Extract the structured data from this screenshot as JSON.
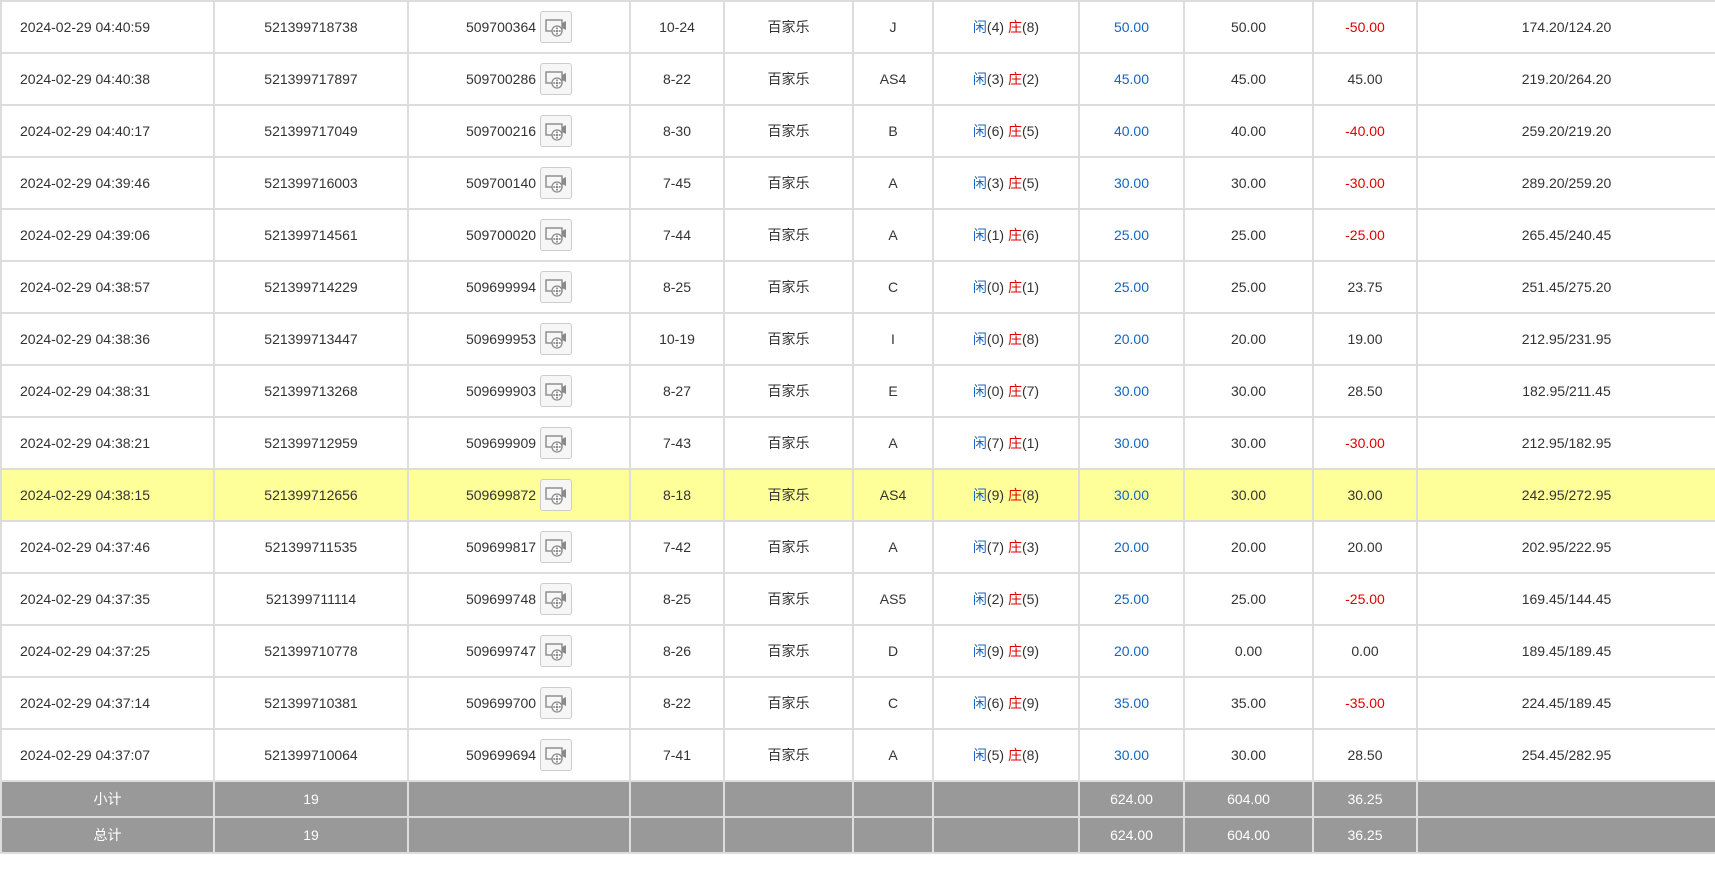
{
  "colors": {
    "highlight": "#ffff99",
    "footer_bg": "#999999",
    "blue": "#1565c0",
    "red": "#e00000",
    "border": "#dddddd"
  },
  "icons": {
    "video": "video-replay-icon"
  },
  "labels": {
    "player": "闲",
    "banker": "庄"
  },
  "rows": [
    {
      "time": "2024-02-29 04:40:59",
      "bet_id": "521399718738",
      "round_id": "509700364",
      "shoe": "10-24",
      "game": "百家乐",
      "table": "J",
      "player_pts": "(4)",
      "banker_pts": "(8)",
      "bet": "50.00",
      "valid": "50.00",
      "win": "-50.00",
      "win_neg": true,
      "balance": "174.20/124.20",
      "highlight": false
    },
    {
      "time": "2024-02-29 04:40:38",
      "bet_id": "521399717897",
      "round_id": "509700286",
      "shoe": "8-22",
      "game": "百家乐",
      "table": "AS4",
      "player_pts": "(3)",
      "banker_pts": "(2)",
      "bet": "45.00",
      "valid": "45.00",
      "win": "45.00",
      "win_neg": false,
      "balance": "219.20/264.20",
      "highlight": false
    },
    {
      "time": "2024-02-29 04:40:17",
      "bet_id": "521399717049",
      "round_id": "509700216",
      "shoe": "8-30",
      "game": "百家乐",
      "table": "B",
      "player_pts": "(6)",
      "banker_pts": "(5)",
      "bet": "40.00",
      "valid": "40.00",
      "win": "-40.00",
      "win_neg": true,
      "balance": "259.20/219.20",
      "highlight": false
    },
    {
      "time": "2024-02-29 04:39:46",
      "bet_id": "521399716003",
      "round_id": "509700140",
      "shoe": "7-45",
      "game": "百家乐",
      "table": "A",
      "player_pts": "(3)",
      "banker_pts": "(5)",
      "bet": "30.00",
      "valid": "30.00",
      "win": "-30.00",
      "win_neg": true,
      "balance": "289.20/259.20",
      "highlight": false
    },
    {
      "time": "2024-02-29 04:39:06",
      "bet_id": "521399714561",
      "round_id": "509700020",
      "shoe": "7-44",
      "game": "百家乐",
      "table": "A",
      "player_pts": "(1)",
      "banker_pts": "(6)",
      "bet": "25.00",
      "valid": "25.00",
      "win": "-25.00",
      "win_neg": true,
      "balance": "265.45/240.45",
      "highlight": false
    },
    {
      "time": "2024-02-29 04:38:57",
      "bet_id": "521399714229",
      "round_id": "509699994",
      "shoe": "8-25",
      "game": "百家乐",
      "table": "C",
      "player_pts": "(0)",
      "banker_pts": "(1)",
      "bet": "25.00",
      "valid": "25.00",
      "win": "23.75",
      "win_neg": false,
      "balance": "251.45/275.20",
      "highlight": false
    },
    {
      "time": "2024-02-29 04:38:36",
      "bet_id": "521399713447",
      "round_id": "509699953",
      "shoe": "10-19",
      "game": "百家乐",
      "table": "I",
      "player_pts": "(0)",
      "banker_pts": "(8)",
      "bet": "20.00",
      "valid": "20.00",
      "win": "19.00",
      "win_neg": false,
      "balance": "212.95/231.95",
      "highlight": false
    },
    {
      "time": "2024-02-29 04:38:31",
      "bet_id": "521399713268",
      "round_id": "509699903",
      "shoe": "8-27",
      "game": "百家乐",
      "table": "E",
      "player_pts": "(0)",
      "banker_pts": "(7)",
      "bet": "30.00",
      "valid": "30.00",
      "win": "28.50",
      "win_neg": false,
      "balance": "182.95/211.45",
      "highlight": false
    },
    {
      "time": "2024-02-29 04:38:21",
      "bet_id": "521399712959",
      "round_id": "509699909",
      "shoe": "7-43",
      "game": "百家乐",
      "table": "A",
      "player_pts": "(7)",
      "banker_pts": "(1)",
      "bet": "30.00",
      "valid": "30.00",
      "win": "-30.00",
      "win_neg": true,
      "balance": "212.95/182.95",
      "highlight": false
    },
    {
      "time": "2024-02-29 04:38:15",
      "bet_id": "521399712656",
      "round_id": "509699872",
      "shoe": "8-18",
      "game": "百家乐",
      "table": "AS4",
      "player_pts": "(9)",
      "banker_pts": "(8)",
      "bet": "30.00",
      "valid": "30.00",
      "win": "30.00",
      "win_neg": false,
      "balance": "242.95/272.95",
      "highlight": true
    },
    {
      "time": "2024-02-29 04:37:46",
      "bet_id": "521399711535",
      "round_id": "509699817",
      "shoe": "7-42",
      "game": "百家乐",
      "table": "A",
      "player_pts": "(7)",
      "banker_pts": "(3)",
      "bet": "20.00",
      "valid": "20.00",
      "win": "20.00",
      "win_neg": false,
      "balance": "202.95/222.95",
      "highlight": false
    },
    {
      "time": "2024-02-29 04:37:35",
      "bet_id": "521399711114",
      "round_id": "509699748",
      "shoe": "8-25",
      "game": "百家乐",
      "table": "AS5",
      "player_pts": "(2)",
      "banker_pts": "(5)",
      "bet": "25.00",
      "valid": "25.00",
      "win": "-25.00",
      "win_neg": true,
      "balance": "169.45/144.45",
      "highlight": false
    },
    {
      "time": "2024-02-29 04:37:25",
      "bet_id": "521399710778",
      "round_id": "509699747",
      "shoe": "8-26",
      "game": "百家乐",
      "table": "D",
      "player_pts": "(9)",
      "banker_pts": "(9)",
      "bet": "20.00",
      "valid": "0.00",
      "win": "0.00",
      "win_neg": false,
      "balance": "189.45/189.45",
      "highlight": false
    },
    {
      "time": "2024-02-29 04:37:14",
      "bet_id": "521399710381",
      "round_id": "509699700",
      "shoe": "8-22",
      "game": "百家乐",
      "table": "C",
      "player_pts": "(6)",
      "banker_pts": "(9)",
      "bet": "35.00",
      "valid": "35.00",
      "win": "-35.00",
      "win_neg": true,
      "balance": "224.45/189.45",
      "highlight": false
    },
    {
      "time": "2024-02-29 04:37:07",
      "bet_id": "521399710064",
      "round_id": "509699694",
      "shoe": "7-41",
      "game": "百家乐",
      "table": "A",
      "player_pts": "(5)",
      "banker_pts": "(8)",
      "bet": "30.00",
      "valid": "30.00",
      "win": "28.50",
      "win_neg": false,
      "balance": "254.45/282.95",
      "highlight": false
    }
  ],
  "subtotal": {
    "label": "小计",
    "count": "19",
    "bet": "624.00",
    "valid": "604.00",
    "win": "36.25"
  },
  "total": {
    "label": "总计",
    "count": "19",
    "bet": "624.00",
    "valid": "604.00",
    "win": "36.25"
  }
}
